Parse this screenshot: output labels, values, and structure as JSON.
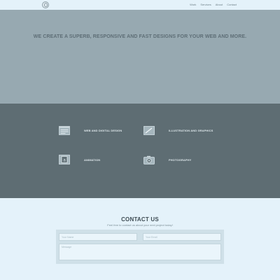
{
  "nav": {
    "logo_icon": "logo-icon",
    "items": [
      {
        "label": "Work"
      },
      {
        "label": "Services"
      },
      {
        "label": "About"
      },
      {
        "label": "Contact"
      }
    ]
  },
  "hero": {
    "title": "WE CREATE A SUPERB, RESPONSIVE AND FAST DESIGNS FOR YOUR WEB AND MORE."
  },
  "services": [
    {
      "label": "WEB AND DIGITAL DESIGN",
      "icon": "browser-window-icon"
    },
    {
      "label": "ILLUSTRATION AND GRAPHICS",
      "icon": "pencil-drawing-icon"
    },
    {
      "label": "ANIMATION",
      "icon": "film-icon"
    },
    {
      "label": "PHOTOGRAPHY",
      "icon": "camera-icon"
    }
  ],
  "contact": {
    "title": "CONTACT US",
    "subtitle": "Feel free to contact us about your next project today!",
    "name_placeholder": "Your Name",
    "email_placeholder": "Your Email",
    "message_placeholder": "Message"
  },
  "colors": {
    "page_bg": "#e4f2fa",
    "hero_bg": "#97a9b1",
    "services_bg": "#5e6d73",
    "form_bg": "#cfe0e8"
  }
}
